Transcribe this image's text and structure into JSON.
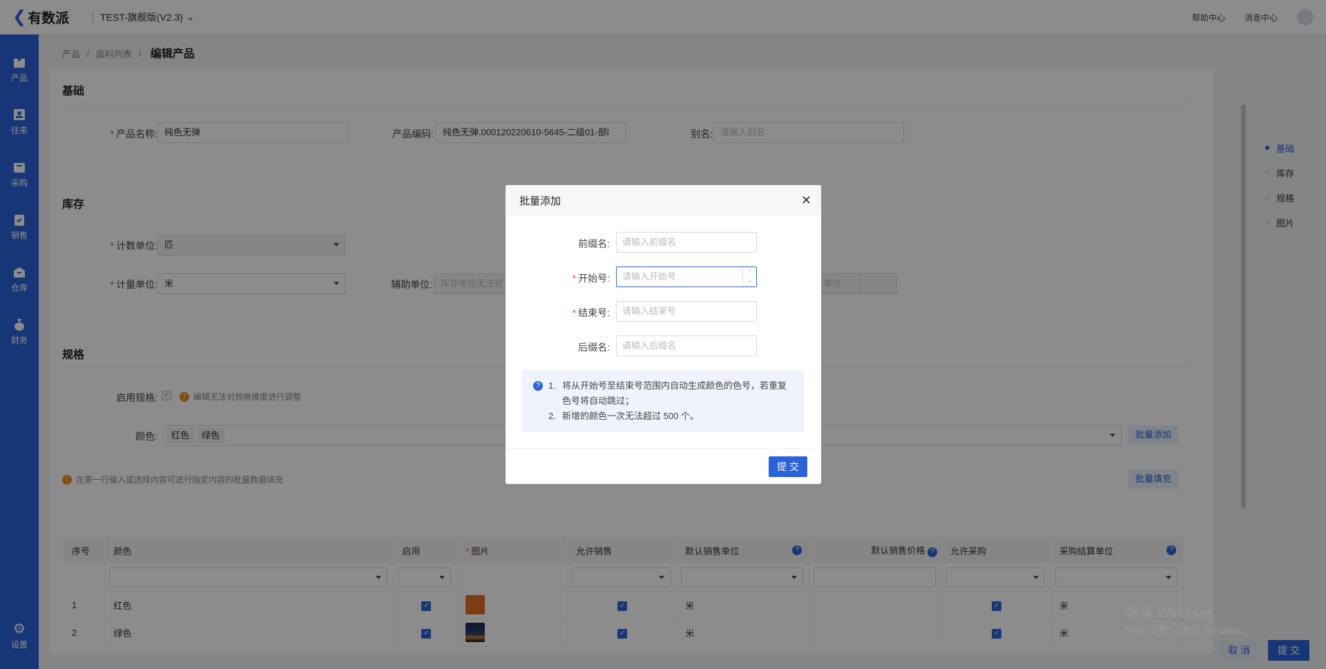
{
  "app": {
    "logo": "有数派",
    "version": "TEST-旗舰版(V2.3)"
  },
  "top_links": {
    "help": "帮助中心",
    "messages": "消息中心"
  },
  "sidebar": {
    "items": [
      {
        "label": "产品",
        "icon": "box-icon"
      },
      {
        "label": "往来",
        "icon": "contact-icon"
      },
      {
        "label": "采购",
        "icon": "cart-icon"
      },
      {
        "label": "销售",
        "icon": "clipboard-icon"
      },
      {
        "label": "仓库",
        "icon": "warehouse-icon"
      },
      {
        "label": "财务",
        "icon": "money-bag-icon"
      }
    ],
    "settings": "设置"
  },
  "breadcrumb": {
    "items": [
      "产品",
      "面料列表"
    ],
    "current": "编辑产品",
    "sep": "/"
  },
  "basic": {
    "title": "基础",
    "name_label": "产品名称:",
    "name_value": "纯色无弹",
    "code_label": "产品编码:",
    "code_value": "纯色无弹,000120220610-5645-二级01-部l",
    "alias_label": "别名:",
    "alias_placeholder": "请输入别名"
  },
  "stock": {
    "title": "库存",
    "count_unit_label": "计数单位:",
    "count_unit_value": "匹",
    "measure_unit_label": "计量单位:",
    "measure_unit_value": "米",
    "aux_unit_label": "辅助单位:",
    "aux_unit_placeholder": "库存单位无法修",
    "aux_unit_tail": "单位"
  },
  "spec": {
    "title": "规格",
    "enable_label": "启用规格:",
    "enable_hint": "编辑无法对规格维度进行调整",
    "color_label": "颜色:",
    "colors": [
      "红色",
      "绿色"
    ],
    "batch_add": "批量添加",
    "fill_hint": "在第一行输入或选择内容可进行指定内容的批量数据填充",
    "batch_fill": "批量填充"
  },
  "table": {
    "headers": [
      "序号",
      "颜色",
      "启用",
      "图片",
      "允许销售",
      "默认销售单位",
      "默认销售价格",
      "允许采购",
      "采购结算单位"
    ],
    "rows": [
      {
        "no": "1",
        "color": "红色",
        "unit": "米",
        "purchase_unit": "米",
        "swatch": "#e07020"
      },
      {
        "no": "2",
        "color": "绿色",
        "unit": "米",
        "purchase_unit": "米",
        "swatch": "#1a2a4a"
      }
    ]
  },
  "right_nav": {
    "items": [
      "基础",
      "库存",
      "规格",
      "图片"
    ],
    "active": "基础"
  },
  "footer": {
    "cancel": "取 消",
    "submit": "提 交"
  },
  "watermark": {
    "line1": "激活 Windows",
    "line2": "转到\"设置\"以激活 Windows。"
  },
  "dialog": {
    "title": "批量添加",
    "prefix_label": "前缀名:",
    "prefix_placeholder": "请输入前缀名",
    "start_label": "开始号:",
    "start_placeholder": "请输入开始号",
    "end_label": "结束号:",
    "end_placeholder": "请输入结束号",
    "suffix_label": "后缀名:",
    "suffix_placeholder": "请输入后缀名",
    "notes": [
      {
        "n": "1.",
        "text": "将从开始号至结束号范围内自动生成颜色的色号，若重复色号将自动跳过；"
      },
      {
        "n": "2.",
        "text": "新增的颜色一次无法超过 500 个。"
      }
    ],
    "submit": "提 交"
  },
  "colors": {
    "primary": "#2b63d9",
    "warning": "#f08a24",
    "required": "#e44444"
  }
}
